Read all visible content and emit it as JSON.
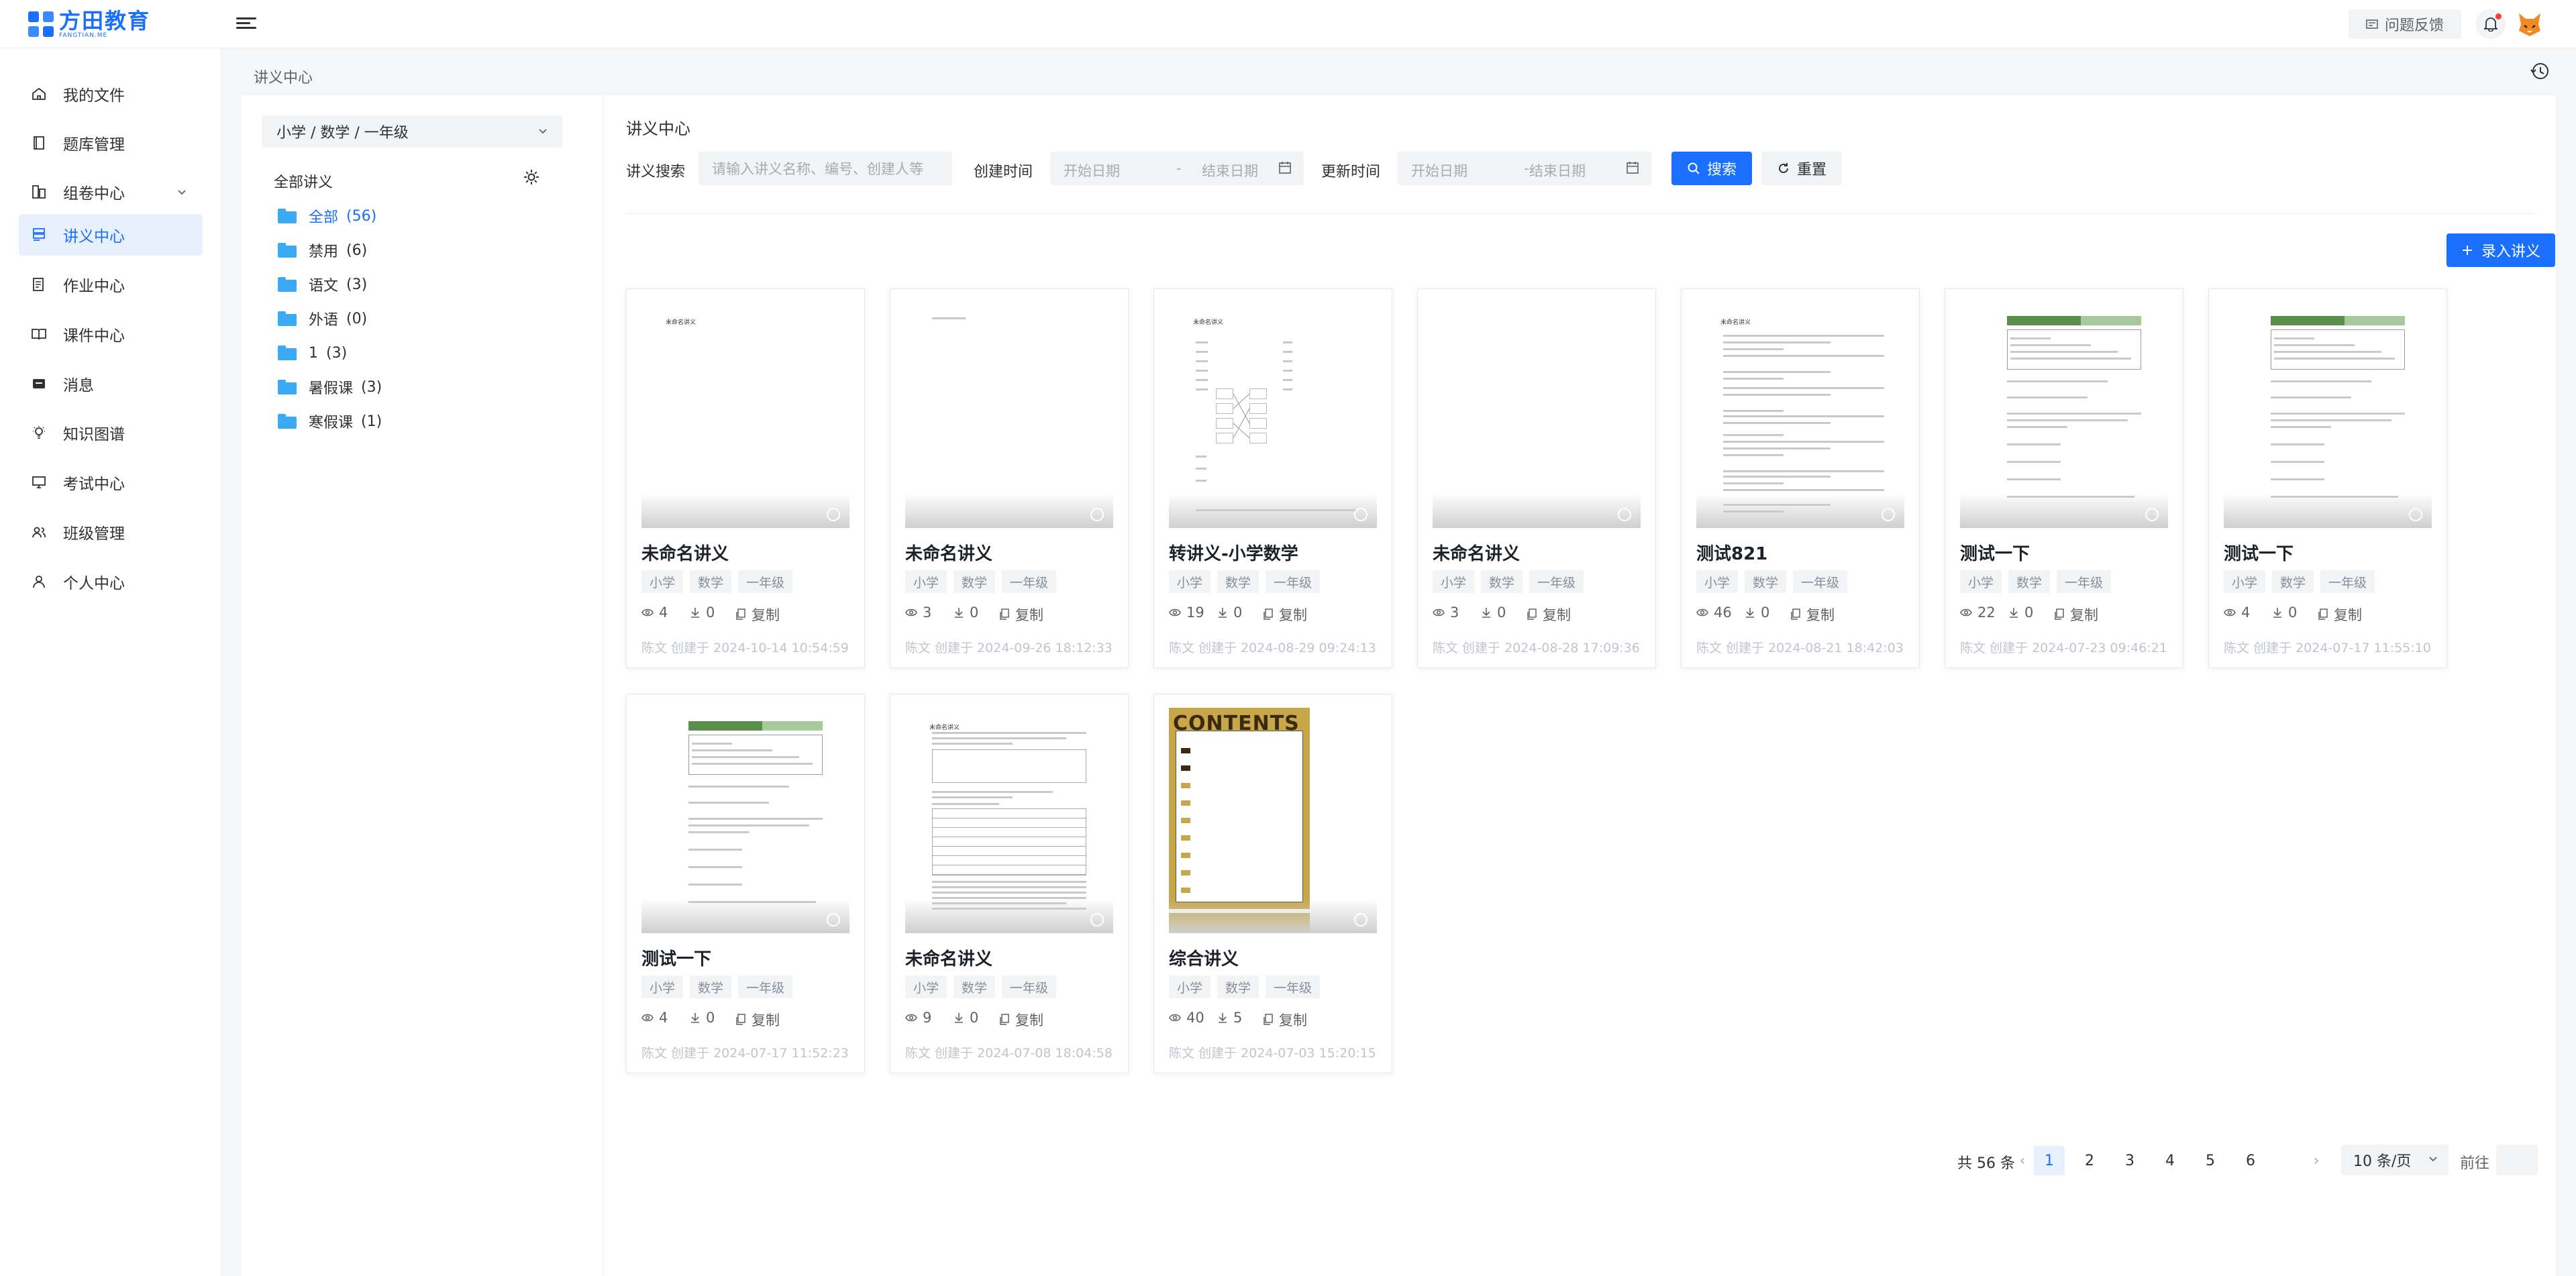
{
  "brand": {
    "name": "方田教育",
    "sub": "FANGTIAN.ME"
  },
  "topbar": {
    "feedback_label": "问题反馈"
  },
  "sidebar": {
    "items": [
      {
        "label": "我的文件",
        "icon": "home-icon"
      },
      {
        "label": "题库管理",
        "icon": "book-icon"
      },
      {
        "label": "组卷中心",
        "icon": "layers-icon"
      },
      {
        "label": "讲义中心",
        "icon": "handout-icon"
      },
      {
        "label": "作业中心",
        "icon": "homework-icon"
      },
      {
        "label": "课件中心",
        "icon": "open-book-icon"
      },
      {
        "label": "消息",
        "icon": "message-icon"
      },
      {
        "label": "知识图谱",
        "icon": "bulb-icon"
      },
      {
        "label": "考试中心",
        "icon": "monitor-icon"
      },
      {
        "label": "班级管理",
        "icon": "users-icon"
      },
      {
        "label": "个人中心",
        "icon": "user-icon"
      }
    ],
    "active_index": 3
  },
  "breadcrumb": "讲义中心",
  "tree": {
    "cascader_value": "小学 / 数学 / 一年级",
    "title": "全部讲义",
    "items": [
      {
        "label": "全部",
        "count": "(56)"
      },
      {
        "label": "禁用",
        "count": "(6)"
      },
      {
        "label": "语文",
        "count": "(3)"
      },
      {
        "label": "外语",
        "count": "(0)"
      },
      {
        "label": "1",
        "count": "(3)"
      },
      {
        "label": "暑假课",
        "count": "(3)"
      },
      {
        "label": "寒假课",
        "count": "(1)"
      }
    ]
  },
  "panel": {
    "title": "讲义中心",
    "search_label": "讲义搜索",
    "search_placeholder": "请输入讲义名称、编号、创建人等",
    "created_label": "创建时间",
    "updated_label": "更新时间",
    "start_placeholder": "开始日期",
    "end_placeholder": "结束日期",
    "range_sep": "-",
    "search_button": "搜索",
    "reset_button": "重置",
    "add_button": "录入讲义"
  },
  "cards": [
    {
      "title": "未命名讲义",
      "tags": [
        "小学",
        "数学",
        "一年级"
      ],
      "views": "4",
      "downloads": "0",
      "copy": "复制",
      "created": "陈文 创建于 2024-10-14 10:54:59",
      "preview": "blank-titled",
      "preview_title": "未命名讲义"
    },
    {
      "title": "未命名讲义",
      "tags": [
        "小学",
        "数学",
        "一年级"
      ],
      "views": "3",
      "downloads": "0",
      "copy": "复制",
      "created": "陈文 创建于 2024-09-26 18:12:33",
      "preview": "blank"
    },
    {
      "title": "转讲义-小学数学",
      "tags": [
        "小学",
        "数学",
        "一年级"
      ],
      "views": "19",
      "downloads": "0",
      "copy": "复制",
      "created": "陈文 创建于 2024-08-29 09:24:13",
      "preview": "matching",
      "preview_title": "未命名讲义"
    },
    {
      "title": "未命名讲义",
      "tags": [
        "小学",
        "数学",
        "一年级"
      ],
      "views": "3",
      "downloads": "0",
      "copy": "复制",
      "created": "陈文 创建于 2024-08-28 17:09:36",
      "preview": "empty"
    },
    {
      "title": "测试821",
      "tags": [
        "小学",
        "数学",
        "一年级"
      ],
      "views": "46",
      "downloads": "0",
      "copy": "复制",
      "created": "陈文 创建于 2024-08-21 18:42:03",
      "preview": "text",
      "preview_title": "未命名讲义"
    },
    {
      "title": "测试一下",
      "tags": [
        "小学",
        "数学",
        "一年级"
      ],
      "views": "22",
      "downloads": "0",
      "copy": "复制",
      "created": "陈文 创建于 2024-07-23 09:46:21",
      "preview": "lesson"
    },
    {
      "title": "测试一下",
      "tags": [
        "小学",
        "数学",
        "一年级"
      ],
      "views": "4",
      "downloads": "0",
      "copy": "复制",
      "created": "陈文 创建于 2024-07-17 11:55:10",
      "preview": "lesson"
    },
    {
      "title": "测试一下",
      "tags": [
        "小学",
        "数学",
        "一年级"
      ],
      "views": "4",
      "downloads": "0",
      "copy": "复制",
      "created": "陈文 创建于 2024-07-17 11:52:23",
      "preview": "lesson"
    },
    {
      "title": "未命名讲义",
      "tags": [
        "小学",
        "数学",
        "一年级"
      ],
      "views": "9",
      "downloads": "0",
      "copy": "复制",
      "created": "陈文 创建于 2024-07-08 18:04:58",
      "preview": "table",
      "preview_title": "未命名讲义"
    },
    {
      "title": "综合讲义",
      "tags": [
        "小学",
        "数学",
        "一年级"
      ],
      "views": "40",
      "downloads": "5",
      "copy": "复制",
      "created": "陈文 创建于 2024-07-03 15:20:15",
      "preview": "contents",
      "preview_title": "CONTENTS"
    }
  ],
  "pagination": {
    "total": "共 56 条",
    "pages": [
      "1",
      "2",
      "3",
      "4",
      "5",
      "6"
    ],
    "current": "1",
    "page_size": "10 条/页",
    "goto_label": "前往"
  },
  "colors": {
    "primary": "#1a6fff",
    "active_bg": "#e8f0fe",
    "folder": "#3aaaf5",
    "contents_gold": "#c8a64a"
  }
}
